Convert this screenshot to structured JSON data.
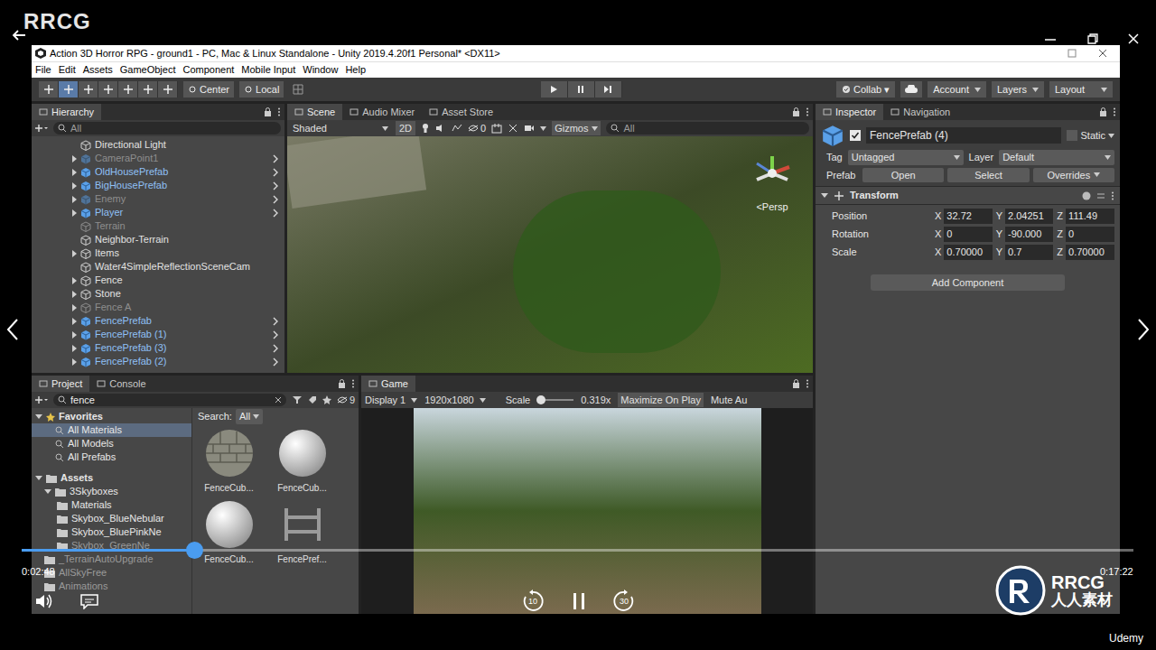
{
  "player": {
    "brand": "RRCG",
    "time_current": "0:02:48",
    "time_total": "0:17:22",
    "progress": {
      "level": 0.155
    },
    "rewind_seconds": "10",
    "forward_seconds": "30",
    "playing": true,
    "logo": {
      "mark": "RRCG",
      "text": "人人素材"
    },
    "provider": "Udemy"
  },
  "window": {
    "title": "Action 3D Horror RPG - ground1 - PC, Mac & Linux Standalone - Unity 2019.4.20f1 Personal* <DX11>"
  },
  "menu": [
    "File",
    "Edit",
    "Assets",
    "GameObject",
    "Component",
    "Mobile Input",
    "Window",
    "Help"
  ],
  "toolbar": {
    "pivot": "Center",
    "space": "Local",
    "collab": "Collab ▾",
    "account": "Account",
    "layers": "Layers",
    "layout": "Layout"
  },
  "hierarchy": {
    "tab": "Hierarchy",
    "search_placeholder": "All",
    "items": [
      {
        "name": "Directional Light",
        "kind": "object",
        "enabled": true,
        "expandable": false
      },
      {
        "name": "CameraPoint1",
        "kind": "prefab",
        "enabled": false,
        "expandable": true
      },
      {
        "name": "OldHousePrefab",
        "kind": "prefab",
        "enabled": true,
        "expandable": true
      },
      {
        "name": "BigHousePrefab",
        "kind": "prefab",
        "enabled": true,
        "expandable": true
      },
      {
        "name": "Enemy",
        "kind": "prefab",
        "enabled": false,
        "expandable": true
      },
      {
        "name": "Player",
        "kind": "prefab",
        "enabled": true,
        "expandable": true
      },
      {
        "name": "Terrain",
        "kind": "object",
        "enabled": false,
        "expandable": false
      },
      {
        "name": "Neighbor-Terrain",
        "kind": "object",
        "enabled": true,
        "expandable": false
      },
      {
        "name": "Items",
        "kind": "object",
        "enabled": true,
        "expandable": true
      },
      {
        "name": "Water4SimpleReflectionSceneCam",
        "kind": "object",
        "enabled": true,
        "expandable": false
      },
      {
        "name": "Fence",
        "kind": "object",
        "enabled": true,
        "expandable": true
      },
      {
        "name": "Stone",
        "kind": "object",
        "enabled": true,
        "expandable": true
      },
      {
        "name": "Fence A",
        "kind": "object",
        "enabled": false,
        "expandable": true
      },
      {
        "name": "FencePrefab",
        "kind": "prefab",
        "enabled": true,
        "expandable": true
      },
      {
        "name": "FencePrefab (1)",
        "kind": "prefab",
        "enabled": true,
        "expandable": true
      },
      {
        "name": "FencePrefab (3)",
        "kind": "prefab",
        "enabled": true,
        "expandable": true
      },
      {
        "name": "FencePrefab (2)",
        "kind": "prefab",
        "enabled": true,
        "expandable": true
      }
    ]
  },
  "scene": {
    "tabs": [
      {
        "label": "Scene",
        "selected": true
      },
      {
        "label": "Audio Mixer",
        "selected": false
      },
      {
        "label": "Asset Store",
        "selected": false
      }
    ],
    "shading": "Shaded",
    "mode_2d": "2D",
    "hidden_count": "0",
    "gizmos": "Gizmos",
    "search_placeholder": "All",
    "projection": "<Persp"
  },
  "inspector": {
    "tabs": [
      {
        "label": "Inspector",
        "selected": true
      },
      {
        "label": "Navigation",
        "selected": false
      }
    ],
    "object": {
      "name": "FencePrefab (4)",
      "active": true,
      "static": "Static",
      "tag_label": "Tag",
      "tag": "Untagged",
      "layer_label": "Layer",
      "layer": "Default",
      "prefab_label": "Prefab",
      "prefab_buttons": [
        "Open",
        "Select",
        "Overrides"
      ]
    },
    "component": {
      "title": "Transform",
      "rows": [
        {
          "label": "Position",
          "values": [
            {
              "axis": "X",
              "value": "32.72"
            },
            {
              "axis": "Y",
              "value": "2.04251"
            },
            {
              "axis": "Z",
              "value": "111.49"
            }
          ]
        },
        {
          "label": "Rotation",
          "values": [
            {
              "axis": "X",
              "value": "0"
            },
            {
              "axis": "Y",
              "value": "-90.000"
            },
            {
              "axis": "Z",
              "value": "0"
            }
          ]
        },
        {
          "label": "Scale",
          "values": [
            {
              "axis": "X",
              "value": "0.70000"
            },
            {
              "axis": "Y",
              "value": "0.7"
            },
            {
              "axis": "Z",
              "value": "0.70000"
            }
          ]
        }
      ]
    },
    "add_component": "Add Component"
  },
  "project": {
    "tabs": [
      {
        "label": "Project",
        "selected": true
      },
      {
        "label": "Console",
        "selected": false
      }
    ],
    "search": "fence",
    "hidden_count": "9",
    "search_scope_label": "Search:",
    "search_scope": "All",
    "favorites": {
      "label": "Favorites",
      "items": [
        {
          "label": "All Materials",
          "selected": true
        },
        {
          "label": "All Models",
          "selected": false
        },
        {
          "label": "All Prefabs",
          "selected": false
        }
      ]
    },
    "assets": {
      "label": "Assets",
      "items": [
        {
          "label": "3Skyboxes",
          "depth": 1,
          "enabled": true
        },
        {
          "label": "Materials",
          "depth": 2,
          "enabled": true
        },
        {
          "label": "Skybox_BlueNebular",
          "depth": 2,
          "enabled": true
        },
        {
          "label": "Skybox_BluePinkNe",
          "depth": 2,
          "enabled": true
        },
        {
          "label": "Skybox_GreenNe",
          "depth": 2,
          "enabled": false
        },
        {
          "label": "_TerrainAutoUpgrade",
          "depth": 1,
          "enabled": false
        },
        {
          "label": "AllSkyFree",
          "depth": 1,
          "enabled": false
        },
        {
          "label": "Animations",
          "depth": 1,
          "enabled": false
        }
      ]
    },
    "results": [
      {
        "label": "FenceCub...",
        "kind": "brick"
      },
      {
        "label": "FenceCub...",
        "kind": "sphere"
      },
      {
        "label": "FenceCub...",
        "kind": "sphere"
      },
      {
        "label": "FencePref...",
        "kind": "fence"
      }
    ]
  },
  "game": {
    "tab": "Game",
    "display": "Display 1",
    "resolution": "1920x1080",
    "scale_label": "Scale",
    "scale": "0.319x",
    "scale_level": 0.1,
    "maximize_on_play": "Maximize On Play",
    "mute": "Mute Au"
  }
}
